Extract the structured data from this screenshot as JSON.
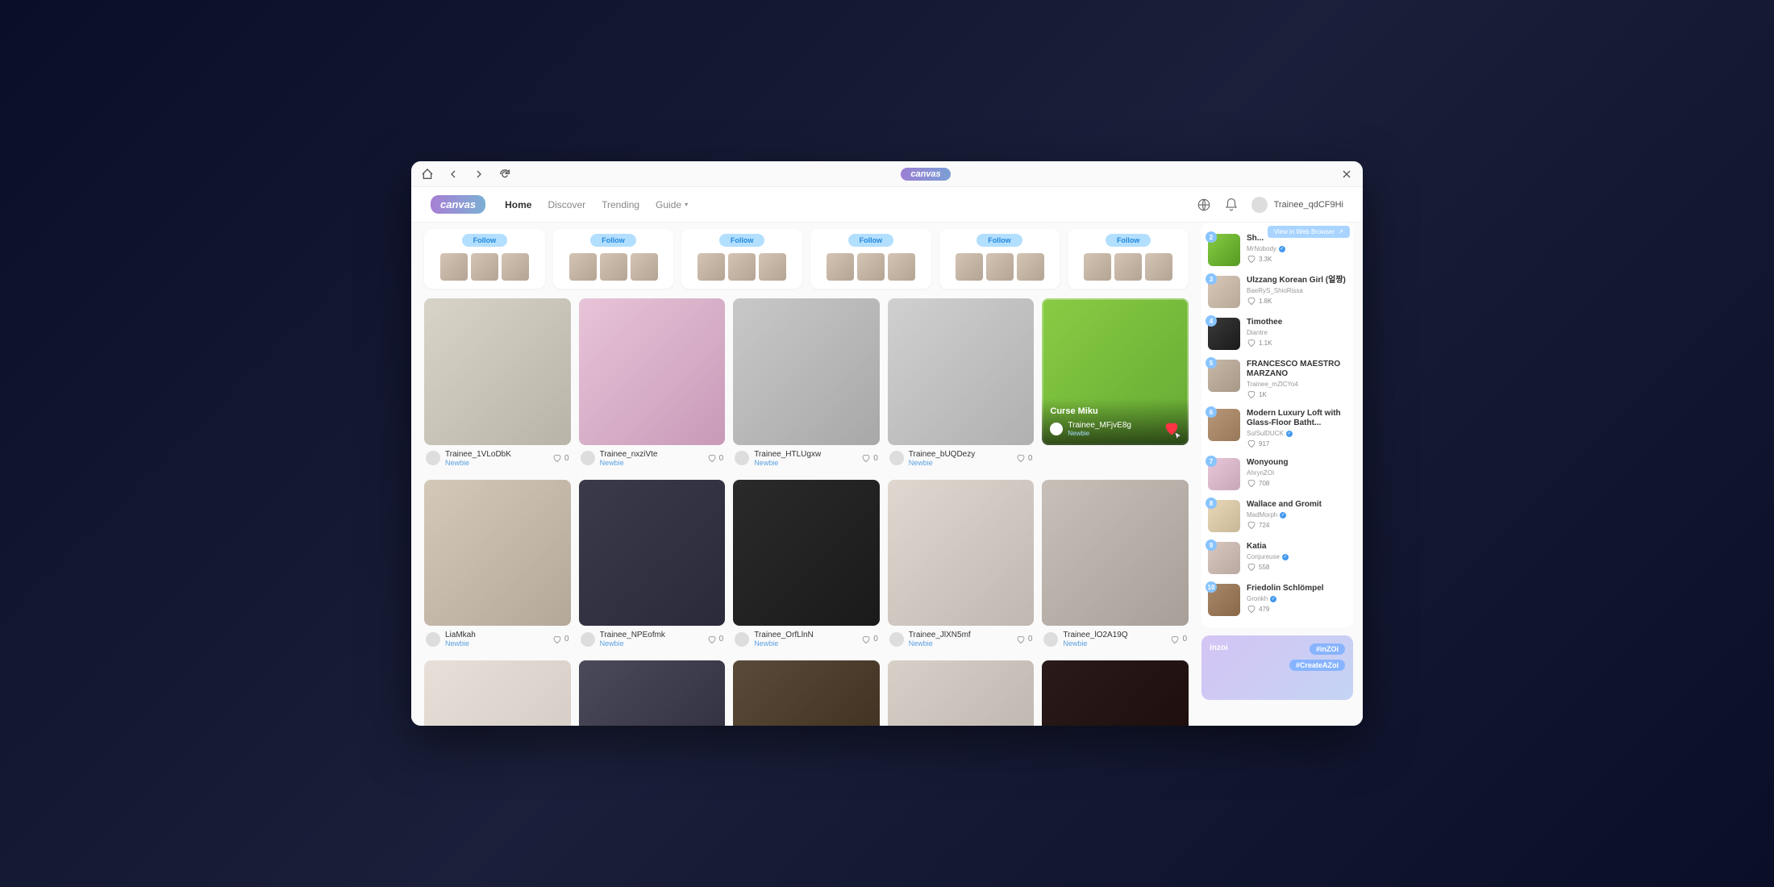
{
  "titlebar": {
    "badge": "canvas"
  },
  "nav": {
    "logo": "canvas",
    "links": [
      "Home",
      "Discover",
      "Trending",
      "Guide"
    ],
    "username": "Trainee_qdCF9Hi"
  },
  "follow_label": "Follow",
  "cards_row1": [
    {
      "user": "Trainee_1VLoDbK",
      "rank": "Newbie",
      "likes": "0",
      "bg": "bg1"
    },
    {
      "user": "Trainee_nxziVte",
      "rank": "Newbie",
      "likes": "0",
      "bg": "bg2"
    },
    {
      "user": "Trainee_HTLUgxw",
      "rank": "Newbie",
      "likes": "0",
      "bg": "bg3"
    },
    {
      "user": "Trainee_bUQDezy",
      "rank": "Newbie",
      "likes": "0",
      "bg": "bg4"
    },
    {
      "user": "Trainee_MFjvE8g",
      "rank": "Newbie",
      "likes": "",
      "bg": "bg5",
      "hovered": true,
      "title": "Curse Miku"
    }
  ],
  "cards_row2": [
    {
      "user": "LiaMkah",
      "rank": "Newbie",
      "likes": "0",
      "bg": "bg6"
    },
    {
      "user": "Trainee_NPEofmk",
      "rank": "Newbie",
      "likes": "0",
      "bg": "bg7"
    },
    {
      "user": "Trainee_OrfLlnN",
      "rank": "Newbie",
      "likes": "0",
      "bg": "bg8"
    },
    {
      "user": "Trainee_JlXN5mf",
      "rank": "Newbie",
      "likes": "0",
      "bg": "bg9"
    },
    {
      "user": "Trainee_lO2A19Q",
      "rank": "Newbie",
      "likes": "0",
      "bg": "bg10"
    }
  ],
  "cards_row3": [
    {
      "bg": "bg11"
    },
    {
      "bg": "bg12"
    },
    {
      "bg": "bg13"
    },
    {
      "bg": "bg14"
    },
    {
      "bg": "bg15"
    }
  ],
  "sidebar": {
    "view_btn": "View in Web Browser",
    "items": [
      {
        "rank": "2",
        "title": "Sh...",
        "author": "MrNobody",
        "verified": true,
        "likes": "3.3K",
        "bg": "sb1"
      },
      {
        "rank": "3",
        "title": "Ulzzang Korean Girl (얼짱)",
        "author": "BaeRyS_ShioRissa",
        "verified": false,
        "likes": "1.8K",
        "bg": "sb2"
      },
      {
        "rank": "4",
        "title": "Timothee",
        "author": "Diantre",
        "verified": false,
        "likes": "1.1K",
        "bg": "sb3"
      },
      {
        "rank": "5",
        "title": "FRANCESCO MAESTRO MARZANO",
        "author": "Trainee_mZlCYo4",
        "verified": false,
        "likes": "1K",
        "bg": "sb4"
      },
      {
        "rank": "6",
        "title": "Modern Luxury Loft with Glass-Floor Batht...",
        "author": "SulSulDUCK",
        "verified": true,
        "likes": "917",
        "bg": "sb5"
      },
      {
        "rank": "7",
        "title": "Wonyoung",
        "author": "AhrynZOI",
        "verified": false,
        "likes": "708",
        "bg": "sb6"
      },
      {
        "rank": "8",
        "title": "Wallace and Gromit",
        "author": "MadMorph",
        "verified": true,
        "likes": "724",
        "bg": "sb7"
      },
      {
        "rank": "9",
        "title": "Katia",
        "author": "Conjureuse",
        "verified": true,
        "likes": "558",
        "bg": "sb8"
      },
      {
        "rank": "10",
        "title": "Friedolin Schlömpel",
        "author": "Gronkh",
        "verified": true,
        "likes": "479",
        "bg": "sb9"
      }
    ]
  },
  "promo": {
    "logo": "inzoi",
    "tag1": "#inZOi",
    "tag2": "#CreateAZoi"
  }
}
